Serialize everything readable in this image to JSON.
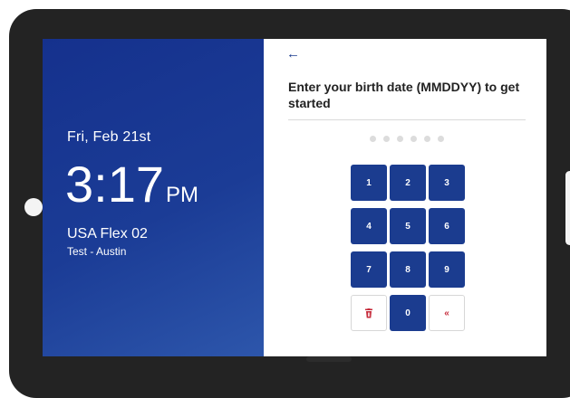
{
  "left_panel": {
    "date": "Fri, Feb 21st",
    "time": "3:17",
    "ampm": "PM",
    "device_name": "USA Flex 02",
    "location": "Test - Austin"
  },
  "right_panel": {
    "back_icon": "←",
    "prompt": "Enter your birth date (MMDDYY) to get started",
    "pin_dot_count": 6,
    "keys": [
      "1",
      "2",
      "3",
      "4",
      "5",
      "6",
      "7",
      "8",
      "9"
    ],
    "delete_icon": "trash-icon",
    "zero": "0",
    "backspace_icon": "«"
  },
  "colors": {
    "primary_blue": "#1b3c8f",
    "delete_red": "#c62b3b",
    "dot_gray": "#dcdcdc"
  }
}
